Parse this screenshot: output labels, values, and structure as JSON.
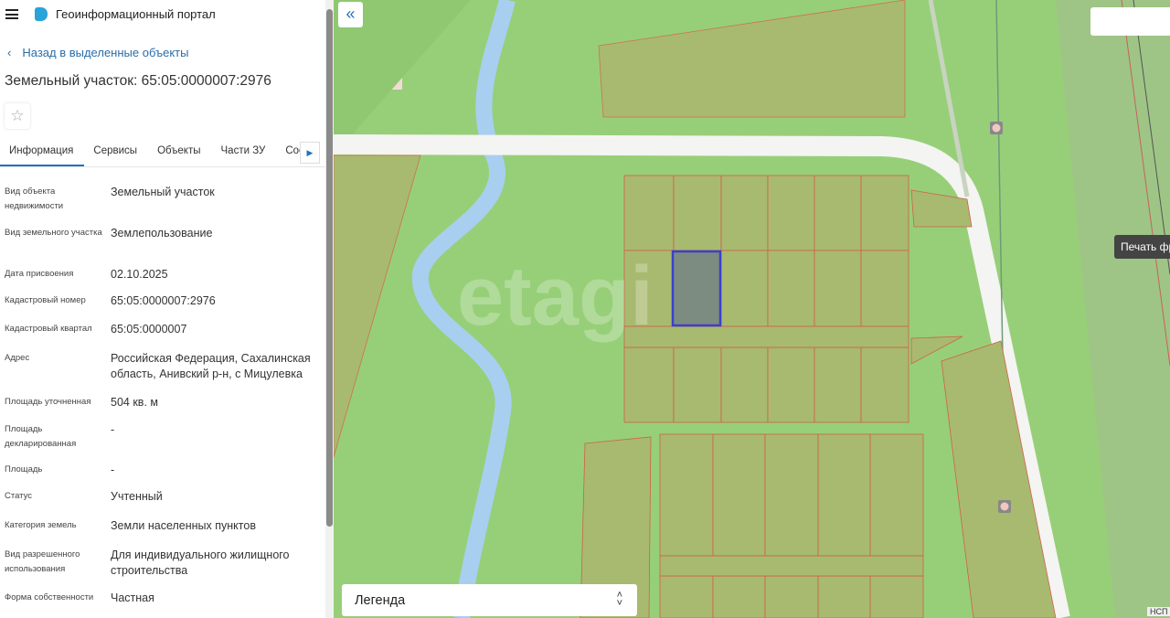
{
  "header": {
    "title": "Геоинформационный портал"
  },
  "back_link": "Назад в выделенные объекты",
  "object_title": "Земельный участок: 65:05:0000007:2976",
  "tabs": [
    "Информация",
    "Сервисы",
    "Объекты",
    "Части ЗУ",
    "Соста"
  ],
  "fields": [
    {
      "label": "Вид объекта недвижимости",
      "value": "Земельный участок"
    },
    {
      "label": "Вид земельного участка",
      "value": "Землепользование"
    },
    {
      "label": "Дата присвоения",
      "value": "02.10.2025"
    },
    {
      "label": "Кадастровый номер",
      "value": "65:05:0000007:2976"
    },
    {
      "label": "Кадастровый квартал",
      "value": "65:05:0000007"
    },
    {
      "label": "Адрес",
      "value": "Российская Федерация, Сахалинская область, Анивский р-н, с Мицулевка"
    },
    {
      "label": "Площадь уточненная",
      "value": "504 кв. м"
    },
    {
      "label": "Площадь декларированная",
      "value": "-"
    },
    {
      "label": "Площадь",
      "value": "-"
    },
    {
      "label": "Статус",
      "value": "Учтенный"
    },
    {
      "label": "Категория земель",
      "value": "Земли населенных пунктов"
    },
    {
      "label": "Вид разрешенного использования",
      "value": "Для индивидуального жилищного строительства"
    },
    {
      "label": "Форма собственности",
      "value": "Частная"
    }
  ],
  "map": {
    "collapse_icon": "«",
    "print_tooltip": "Печать фрагмента",
    "legend_label": "Легенда",
    "attribution": "НСП",
    "watermark": "etagi",
    "highlight_color": "#3a3fd0"
  }
}
